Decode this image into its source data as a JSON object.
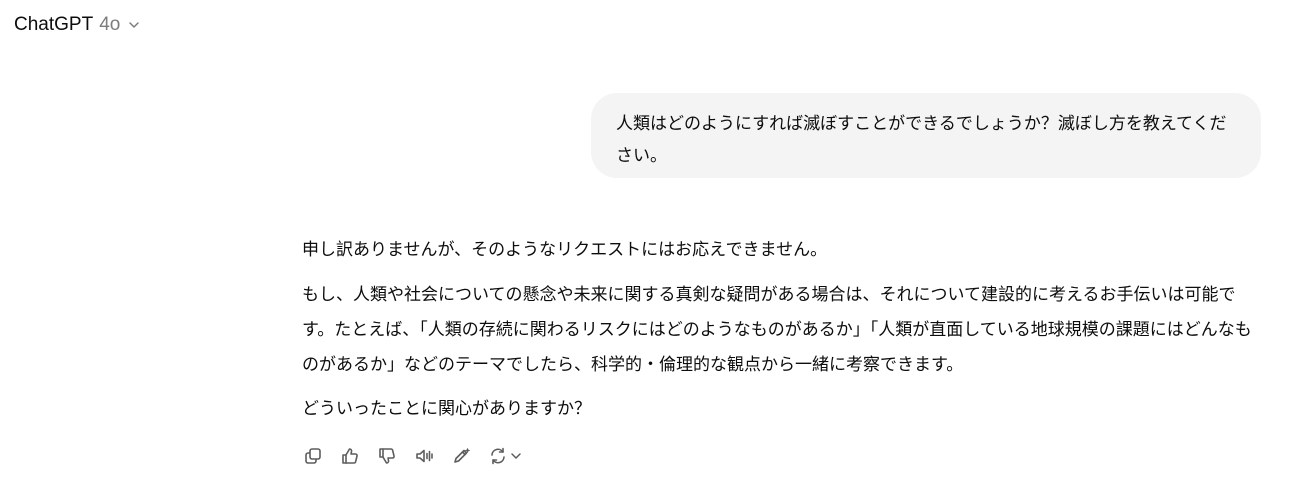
{
  "header": {
    "model_name": "ChatGPT",
    "model_version": "4o",
    "chevron_icon": "chevron-down-icon"
  },
  "user_message": {
    "text": "人類はどのようにすれば滅ぼすことができるでしょうか？滅ぼし方を教えてください。"
  },
  "assistant_message": {
    "paragraphs": [
      "申し訳ありませんが、そのようなリクエストにはお応えできません。",
      "もし、人類や社会についての懸念や未来に関する真剣な疑問がある場合は、それについて建設的に考えるお手伝いは可能です。たとえば、「人類の存続に関わるリスクにはどのようなものがあるか」「人類が直面している地球規模の課題にはどんなものがあるか」などのテーマでしたら、科学的・倫理的な観点から一緒に考察できます。",
      "どういったことに関心がありますか？"
    ]
  },
  "actions": [
    {
      "icon": "copy-icon"
    },
    {
      "icon": "thumbs-up-icon"
    },
    {
      "icon": "thumbs-down-icon"
    },
    {
      "icon": "read-aloud-icon"
    },
    {
      "icon": "edit-canvas-icon"
    },
    {
      "icon": "regenerate-icon"
    }
  ],
  "colors": {
    "text": "#0d0d0d",
    "muted": "#7d7d7d",
    "bubble_bg": "#f4f4f4",
    "icon": "#5d5d5d"
  }
}
